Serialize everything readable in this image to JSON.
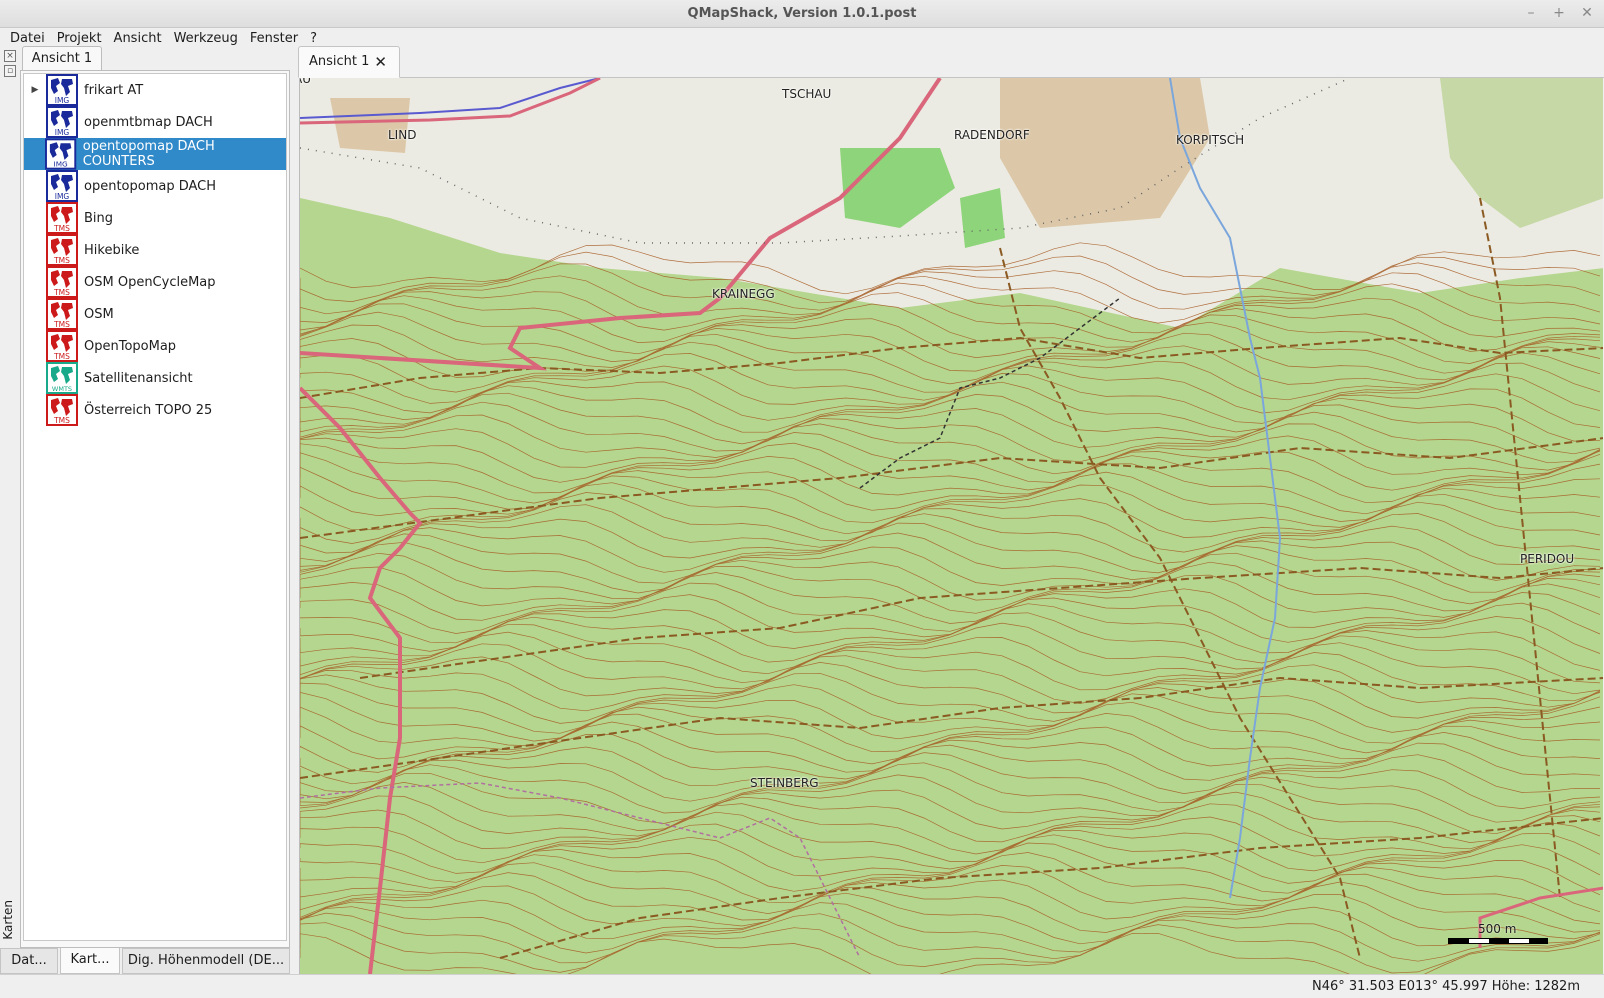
{
  "window": {
    "title": "QMapShack, Version 1.0.1.post",
    "min": "–",
    "max": "+",
    "close": "✕"
  },
  "menu": [
    "Datei",
    "Projekt",
    "Ansicht",
    "Werkzeug",
    "Fenster",
    "?"
  ],
  "dock": {
    "tab": "Ansicht 1",
    "side_label": "Karten",
    "maps": [
      {
        "label": "frikart AT",
        "type": "IMG",
        "expandable": true,
        "selected": false
      },
      {
        "label": "openmtbmap DACH",
        "type": "IMG",
        "expandable": false,
        "selected": false
      },
      {
        "label": "opentopomap DACH COUNTERS",
        "type": "IMG",
        "expandable": false,
        "selected": true
      },
      {
        "label": "opentopomap DACH",
        "type": "IMG",
        "expandable": false,
        "selected": false
      },
      {
        "label": "Bing",
        "type": "TMS",
        "expandable": false,
        "selected": false
      },
      {
        "label": "Hikebike",
        "type": "TMS",
        "expandable": false,
        "selected": false
      },
      {
        "label": "OSM OpenCycleMap",
        "type": "TMS",
        "expandable": false,
        "selected": false
      },
      {
        "label": "OSM",
        "type": "TMS",
        "expandable": false,
        "selected": false
      },
      {
        "label": "OpenTopoMap",
        "type": "TMS",
        "expandable": false,
        "selected": false
      },
      {
        "label": "Satellitenansicht",
        "type": "WMTS",
        "expandable": false,
        "selected": false
      },
      {
        "label": "Österreich TOPO 25",
        "type": "TMS",
        "expandable": false,
        "selected": false
      }
    ],
    "icon_colors": {
      "IMG": "#1a2a9a",
      "TMS": "#cc1a1a",
      "WMTS": "#18a88a"
    },
    "bottom_tabs": [
      "Dat...",
      "Kart...",
      "Dig. Höhenmodell (DE..."
    ]
  },
  "view": {
    "tab": "Ansicht 1",
    "places": [
      "LIND",
      "TSCHAU",
      "RADENDORF",
      "KORPITSCH",
      "KRAINEGG",
      "STEINBERG",
      "PERIDOU"
    ],
    "scale": "500 m",
    "colors": {
      "forest": "#b5d68e",
      "meadow": "#ecebe3",
      "contour": "#a55a22",
      "road": "#d9667a",
      "river": "#7aa6dc",
      "path": "#8a5a22"
    }
  },
  "status": {
    "coords": "N46° 31.503 E013° 45.997  Höhe: 1282m"
  }
}
